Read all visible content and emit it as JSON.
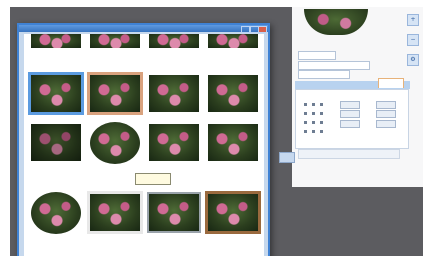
{
  "back_window": {
    "preview_title": "",
    "toolbar_icons": [
      "plus-icon",
      "minus-icon",
      "gear-icon"
    ],
    "tab_strip_label": "",
    "active_tab_label": "",
    "panel_label": ""
  },
  "main_window": {
    "title": ""
  },
  "gallery": {
    "rows": [
      {
        "items": [
          {
            "caption": "",
            "frame": "none",
            "shape": "half"
          },
          {
            "caption": "",
            "frame": "none",
            "shape": "half"
          },
          {
            "caption": "",
            "frame": "none",
            "shape": "half"
          },
          {
            "caption": "",
            "frame": "none",
            "shape": "half"
          }
        ]
      },
      {
        "items": [
          {
            "caption": "",
            "frame": "blue",
            "shape": "rect"
          },
          {
            "caption": "",
            "frame": "tan",
            "shape": "rect"
          },
          {
            "caption": "",
            "frame": "none",
            "shape": "rect"
          },
          {
            "caption": "",
            "frame": "none",
            "shape": "rect"
          }
        ]
      },
      {
        "items": [
          {
            "caption": "",
            "frame": "none",
            "shape": "rect-dark"
          },
          {
            "caption": "",
            "frame": "none",
            "shape": "oval"
          },
          {
            "caption": "",
            "frame": "none",
            "shape": "rect"
          },
          {
            "caption": "",
            "frame": "none",
            "shape": "rect"
          }
        ]
      },
      {
        "items": [
          {
            "caption": "",
            "frame": "none",
            "shape": "oval",
            "selected": true
          },
          {
            "caption": "",
            "frame": "white",
            "shape": "rect"
          },
          {
            "caption": "",
            "frame": "gray",
            "shape": "rect"
          },
          {
            "caption": "",
            "frame": "brown",
            "shape": "rect"
          }
        ]
      }
    ]
  },
  "colors": {
    "accent": "#3f82d4",
    "selection": "#4a8ad8",
    "backdrop": "#5c5c60"
  }
}
